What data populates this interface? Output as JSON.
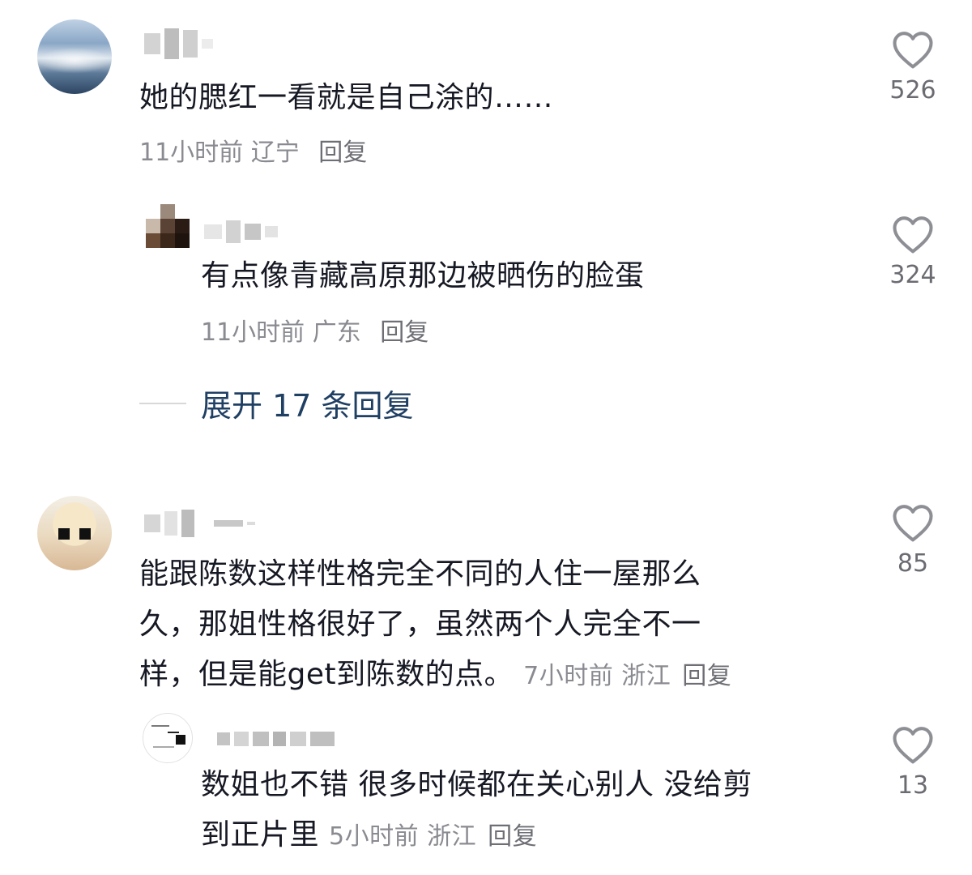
{
  "colors": {
    "text": "#161823",
    "meta": "#8a8b91",
    "expand_link": "#1f3f63",
    "heart_outline": "#8e8f94"
  },
  "comments": [
    {
      "text": "她的腮红一看就是自己涂的……",
      "time": "11小时前",
      "location": "辽宁",
      "reply": "回复",
      "likes": "526",
      "like_icon": "heart-outline-icon",
      "replies": [
        {
          "text": "有点像青藏高原那边被晒伤的脸蛋",
          "time": "11小时前",
          "location": "广东",
          "reply": "回复",
          "likes": "324",
          "like_icon": "heart-outline-icon"
        }
      ],
      "expand_label": "展开 17 条回复"
    },
    {
      "text_lines": [
        "能跟陈数这样性格完全不同的人住一屋那么",
        "久，那姐性格很好了，虽然两个人完全不一",
        "样，但是能get到陈数的点。"
      ],
      "time": "7小时前",
      "location": "浙江",
      "reply": "回复",
      "likes": "85",
      "like_icon": "heart-outline-icon",
      "replies": [
        {
          "text_lines": [
            "数姐也不错 很多时候都在关心别人 没给剪",
            "到正片里"
          ],
          "time": "5小时前",
          "location": "浙江",
          "reply": "回复",
          "likes": "13",
          "like_icon": "heart-outline-icon"
        }
      ]
    }
  ]
}
